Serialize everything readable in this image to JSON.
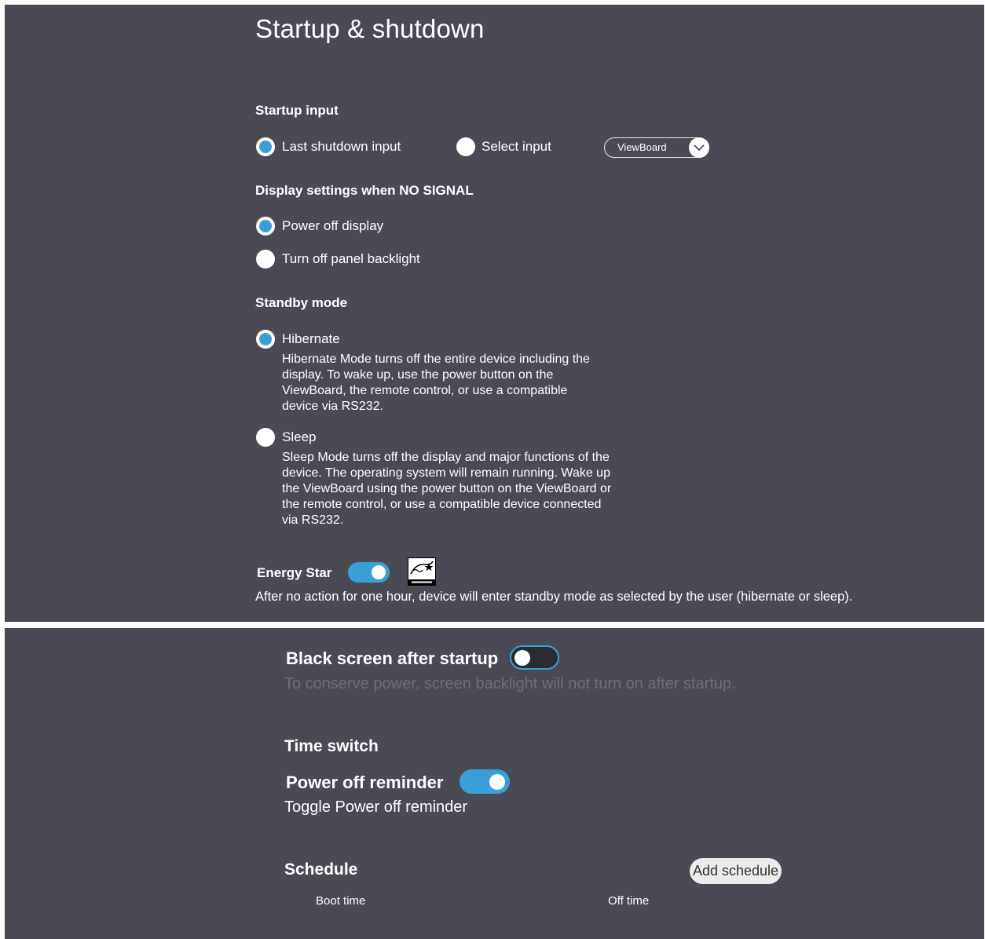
{
  "page": {
    "title": "Startup & shutdown"
  },
  "startup_input": {
    "heading": "Startup input",
    "options": [
      {
        "label": "Last shutdown input",
        "checked": true
      },
      {
        "label": "Select input",
        "checked": false
      }
    ],
    "select_value": "ViewBoard"
  },
  "no_signal": {
    "heading": "Display settings when NO SIGNAL",
    "options": [
      {
        "label": "Power off display",
        "checked": true
      },
      {
        "label": "Turn off panel backlight",
        "checked": false
      }
    ]
  },
  "standby": {
    "heading": "Standby mode",
    "options": [
      {
        "label": "Hibernate",
        "checked": true,
        "description": "Hibernate Mode turns off the entire device including the display. To wake up, use the power button on the ViewBoard, the remote control, or use a compatible device via RS232."
      },
      {
        "label": "Sleep",
        "checked": false,
        "description": "Sleep Mode turns off the display and major functions of the device. The operating system will remain running. Wake up the ViewBoard using the power button on the ViewBoard or the remote control, or use a compatible device connected via RS232."
      }
    ]
  },
  "energy_star": {
    "label": "Energy Star",
    "enabled": true,
    "note": "After no action for one hour, device will enter standby mode as selected by the user (hibernate or sleep).",
    "logo_icon": "energy-star-logo"
  },
  "black_screen": {
    "label": "Black screen after startup",
    "enabled": false,
    "description": "To conserve power, screen backlight will not turn on after startup."
  },
  "time_switch": {
    "heading": "Time switch"
  },
  "power_off_reminder": {
    "label": "Power off reminder",
    "enabled": true,
    "description": "Toggle Power off reminder"
  },
  "schedule": {
    "heading": "Schedule",
    "add_button": "Add schedule",
    "columns": [
      "Boot time",
      "Off time"
    ]
  },
  "colors": {
    "accent": "#3a9fd6",
    "panel": "#4a4a55",
    "muted": "#6e6e78"
  }
}
